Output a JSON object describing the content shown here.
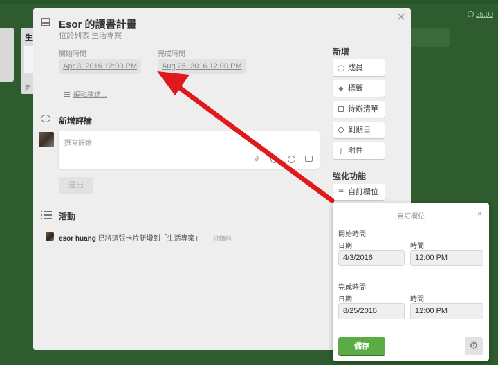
{
  "board": {
    "time": "25.00",
    "list_fragment": "生",
    "list_footer_fragment": "新"
  },
  "card": {
    "title": "Esor 的讀書計畫",
    "in_list_prefix": "位於列表",
    "in_list_name": "生活專案",
    "start_label": "開始時間",
    "start_value": "Apr 3, 2016 12:00 PM",
    "due_label": "完成時間",
    "due_value": "Aug 25, 2016 12:00 PM",
    "edit_desc": "編輯敘述...",
    "close_icon": "×"
  },
  "comment": {
    "section_title": "新增評論",
    "placeholder": "撰寫評論",
    "send": "送出"
  },
  "activity": {
    "section_title": "活動",
    "user": "esor huang",
    "text": "已將這張卡片新增到「生活專案」",
    "time": "一分鐘前"
  },
  "sidebar": {
    "add_heading": "新增",
    "add_buttons": [
      {
        "label": "成員",
        "icon": "person-icon"
      },
      {
        "label": "標籤",
        "icon": "tag-icon"
      },
      {
        "label": "待辦清單",
        "icon": "checklist-icon"
      },
      {
        "label": "到期日",
        "icon": "clock-icon"
      },
      {
        "label": "附件",
        "icon": "paperclip-icon"
      }
    ],
    "powerups_heading": "強化功能",
    "custom_fields_button": "自訂欄位"
  },
  "popover": {
    "title": "自訂欄位",
    "close": "×",
    "start_section": "開始時間",
    "due_section": "完成時間",
    "date_label": "日期",
    "time_label": "時間",
    "start_date": "4/3/2016",
    "start_time": "12:00 PM",
    "due_date": "8/25/2016",
    "due_time": "12:00 PM",
    "save": "儲存"
  },
  "colors": {
    "board_bg": "#2e5c2e",
    "save_green": "#5aac44",
    "arrow_red": "#e0191c"
  }
}
